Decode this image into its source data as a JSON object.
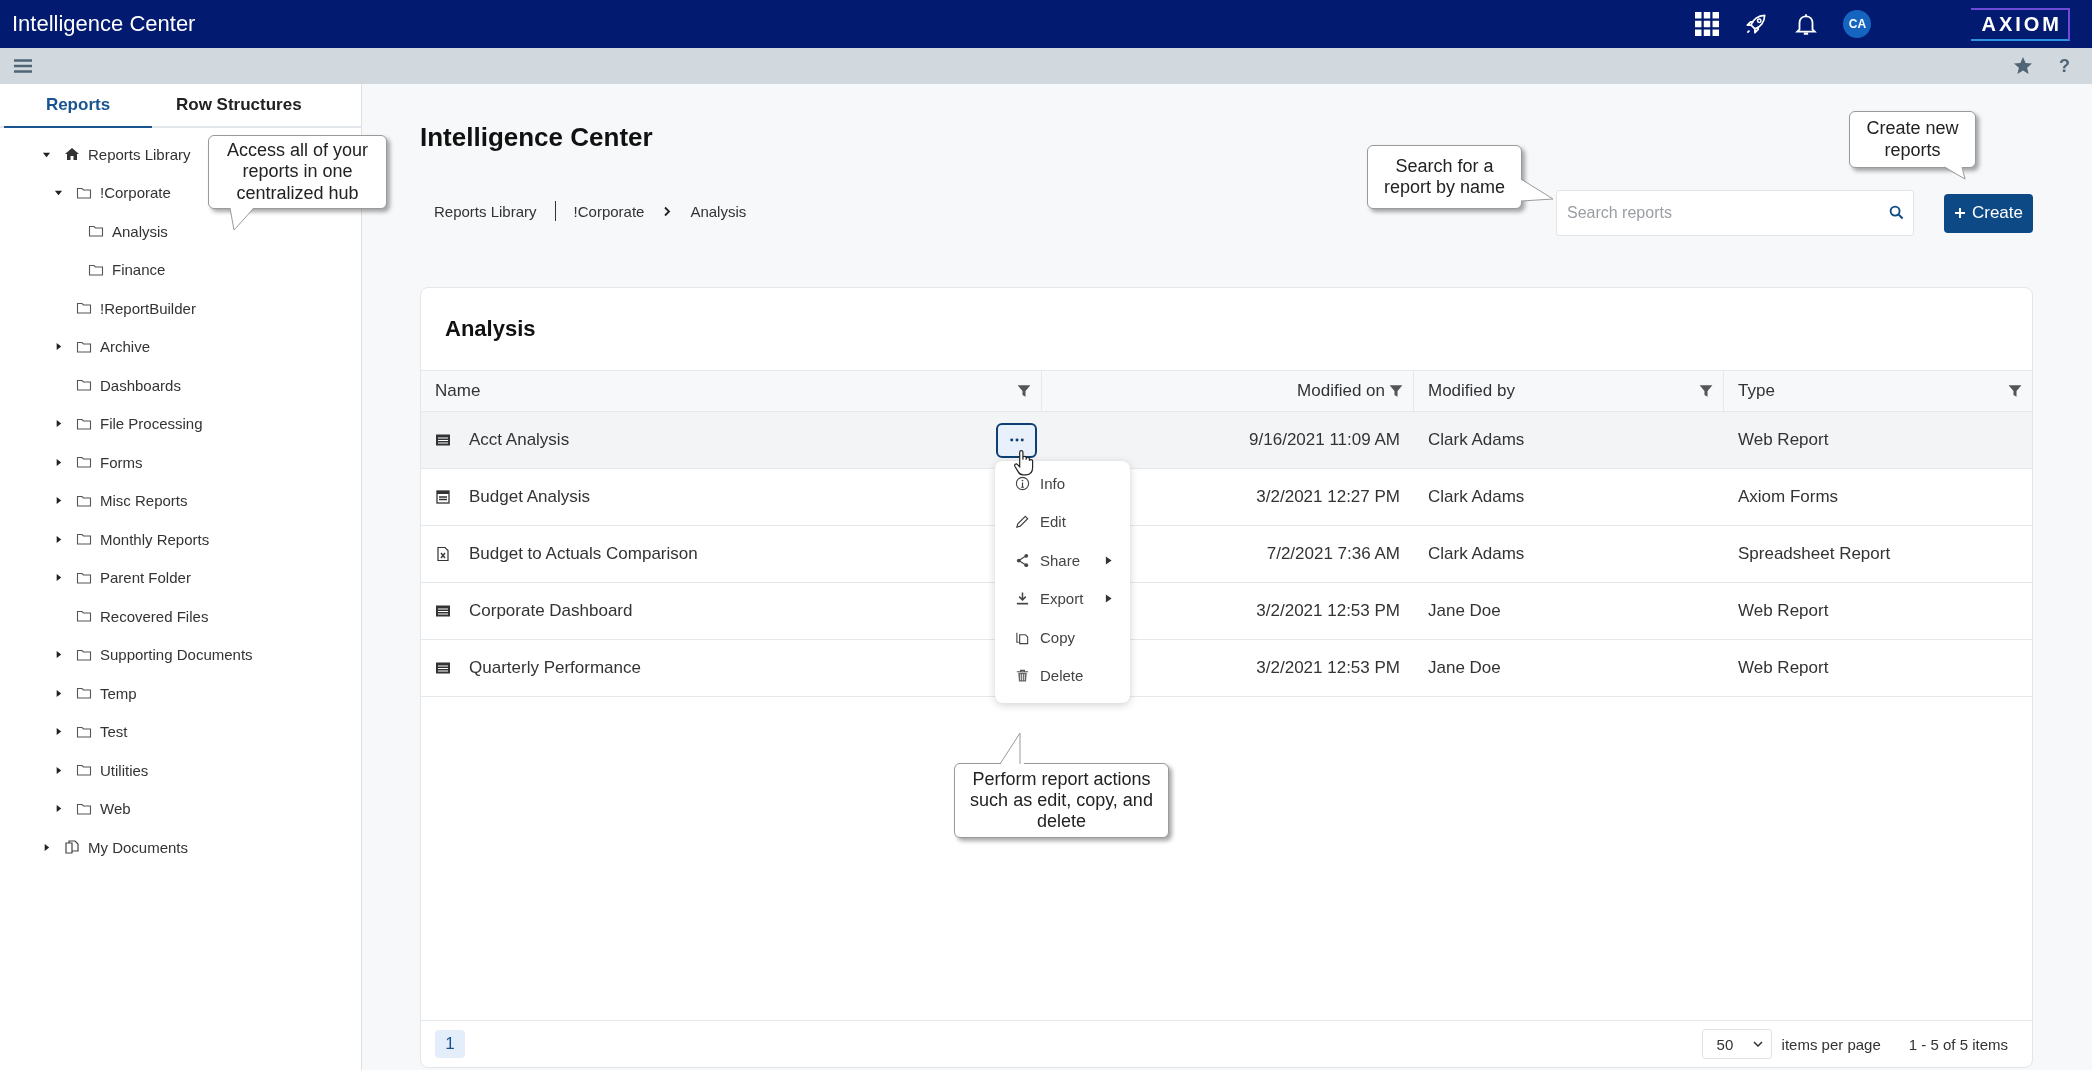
{
  "app": {
    "title": "Intelligence Center",
    "avatar_initials": "CA",
    "logo": "AXIOM"
  },
  "toolbar": {
    "help_label": "?"
  },
  "sidebar": {
    "tabs": [
      {
        "label": "Reports",
        "selected": true
      },
      {
        "label": "Row Structures",
        "selected": false
      }
    ],
    "tree": [
      {
        "label": "Reports Library",
        "kind": "home",
        "expanded": true,
        "children": [
          {
            "label": "!Corporate",
            "kind": "folder",
            "expanded": true,
            "children": [
              {
                "label": "Analysis",
                "kind": "folder"
              },
              {
                "label": "Finance",
                "kind": "folder"
              }
            ]
          },
          {
            "label": "!ReportBuilder",
            "kind": "folder"
          },
          {
            "label": "Archive",
            "kind": "folder",
            "expanded": false
          },
          {
            "label": "Dashboards",
            "kind": "folder"
          },
          {
            "label": "File Processing",
            "kind": "folder",
            "expanded": false
          },
          {
            "label": "Forms",
            "kind": "folder",
            "expanded": false
          },
          {
            "label": "Misc Reports",
            "kind": "folder",
            "expanded": false
          },
          {
            "label": "Monthly Reports",
            "kind": "folder",
            "expanded": false
          },
          {
            "label": "Parent Folder",
            "kind": "folder",
            "expanded": false
          },
          {
            "label": "Recovered Files",
            "kind": "folder"
          },
          {
            "label": "Supporting Documents",
            "kind": "folder",
            "expanded": false
          },
          {
            "label": "Temp",
            "kind": "folder",
            "expanded": false
          },
          {
            "label": "Test",
            "kind": "folder",
            "expanded": false
          },
          {
            "label": "Utilities",
            "kind": "folder",
            "expanded": false
          },
          {
            "label": "Web",
            "kind": "folder",
            "expanded": false
          }
        ]
      },
      {
        "label": "My Documents",
        "kind": "documents",
        "expanded": false
      }
    ]
  },
  "page": {
    "title": "Intelligence Center",
    "breadcrumb": [
      "Reports Library",
      "!Corporate",
      "Analysis"
    ],
    "search": {
      "placeholder": "Search reports"
    },
    "create_button": "Create"
  },
  "card": {
    "title": "Analysis",
    "columns": [
      "Name",
      "Modified on",
      "Modified by",
      "Type"
    ],
    "rows": [
      {
        "name": "Acct Analysis",
        "kind": "web",
        "modified_on": "9/16/2021 11:09 AM",
        "modified_by": "Clark Adams",
        "type": "Web Report",
        "selected": true
      },
      {
        "name": "Budget Analysis",
        "kind": "form",
        "modified_on": "3/2/2021 12:27 PM",
        "modified_by": "Clark Adams",
        "type": "Axiom Forms",
        "selected": false
      },
      {
        "name": "Budget to Actuals Comparison",
        "kind": "spreadsheet",
        "modified_on": "7/2/2021 7:36 AM",
        "modified_by": "Clark Adams",
        "type": "Spreadsheet Report",
        "selected": false
      },
      {
        "name": "Corporate Dashboard",
        "kind": "web",
        "modified_on": "3/2/2021 12:53 PM",
        "modified_by": "Jane Doe",
        "type": "Web Report",
        "selected": false
      },
      {
        "name": "Quarterly Performance",
        "kind": "web",
        "modified_on": "3/2/2021 12:53 PM",
        "modified_by": "Jane Doe",
        "type": "Web Report",
        "selected": false
      }
    ],
    "actions_menu": {
      "open": true,
      "items": [
        {
          "label": "Info",
          "kind": "info",
          "submenu": false
        },
        {
          "label": "Edit",
          "kind": "edit",
          "submenu": false
        },
        {
          "label": "Share",
          "kind": "share",
          "submenu": true
        },
        {
          "label": "Export",
          "kind": "export",
          "submenu": true
        },
        {
          "label": "Copy",
          "kind": "copy",
          "submenu": false
        },
        {
          "label": "Delete",
          "kind": "delete",
          "submenu": false
        }
      ]
    },
    "pagination": {
      "pages": [
        {
          "label": "1",
          "selected": true
        }
      ],
      "page_size": "50",
      "page_size_label": "items per page",
      "summary": "1 - 5 of 5 items"
    }
  },
  "callouts": [
    {
      "text": "Access all of your reports in one centralized hub",
      "kind": "down-left"
    },
    {
      "text": "Search for a report by name",
      "kind": "right"
    },
    {
      "text": "Create new reports",
      "kind": "down-right"
    },
    {
      "text": "Perform report actions such as edit, copy, and delete",
      "kind": "up"
    }
  ]
}
